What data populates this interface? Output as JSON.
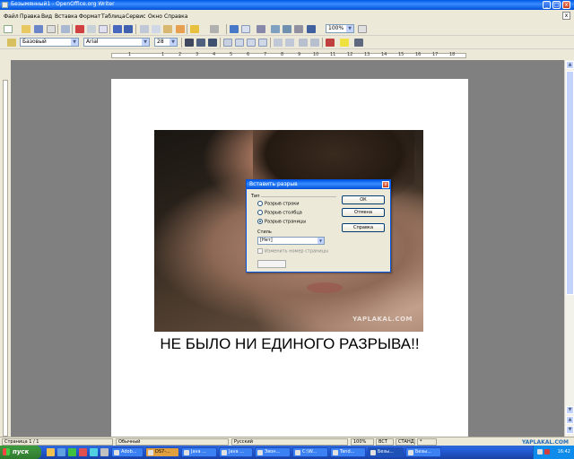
{
  "window": {
    "title": "Безымянный1 - OpenOffice.org Writer",
    "min": "_",
    "max": "□",
    "close": "x"
  },
  "menu": [
    "Файл",
    "Правка",
    "Вид",
    "Вставка",
    "Формат",
    "Таблица",
    "Сервис",
    "Окно",
    "Справка"
  ],
  "doc_close": "x",
  "toolbar": {
    "zoom": "100%",
    "style": "Базовый",
    "font": "Arial",
    "size": "28"
  },
  "ruler": [
    "1",
    "1",
    "2",
    "3",
    "4",
    "5",
    "6",
    "7",
    "8",
    "9",
    "10",
    "11",
    "12",
    "13",
    "14",
    "15",
    "16",
    "17",
    "18"
  ],
  "document": {
    "watermark": "YAPLAKAL.COM",
    "caption": "НЕ БЫЛО НИ ЕДИНОГО РАЗРЫВА!!"
  },
  "dialog": {
    "title": "Вставить разрыв",
    "type_label": "Тип",
    "options": [
      "Разрыв строки",
      "Разрыв столбца",
      "Разрыв страницы"
    ],
    "selected_option": "Разрыв страницы",
    "style_label": "Стиль",
    "style_value": "[Нет]",
    "change_page_number": "Изменить номер страницы",
    "ok": "ОК",
    "cancel": "Отмена",
    "help": "Справка"
  },
  "status": {
    "page": "Страница 1 / 1",
    "page_style": "Обычный",
    "language": "Русский",
    "zoom": "100%",
    "insert_mode": "ВСТ",
    "select_mode": "СТАНД",
    "modified": "*"
  },
  "taskbar": {
    "start": "пуск",
    "tasks": [
      "Adob...",
      "DS7-...",
      "Java ...",
      "Java ...",
      "Звон...",
      "C:\\W...",
      "Tand...",
      "Безы...",
      "Безы..."
    ],
    "time": "16:42"
  },
  "site_watermark": "YAPLAKAL.COM"
}
